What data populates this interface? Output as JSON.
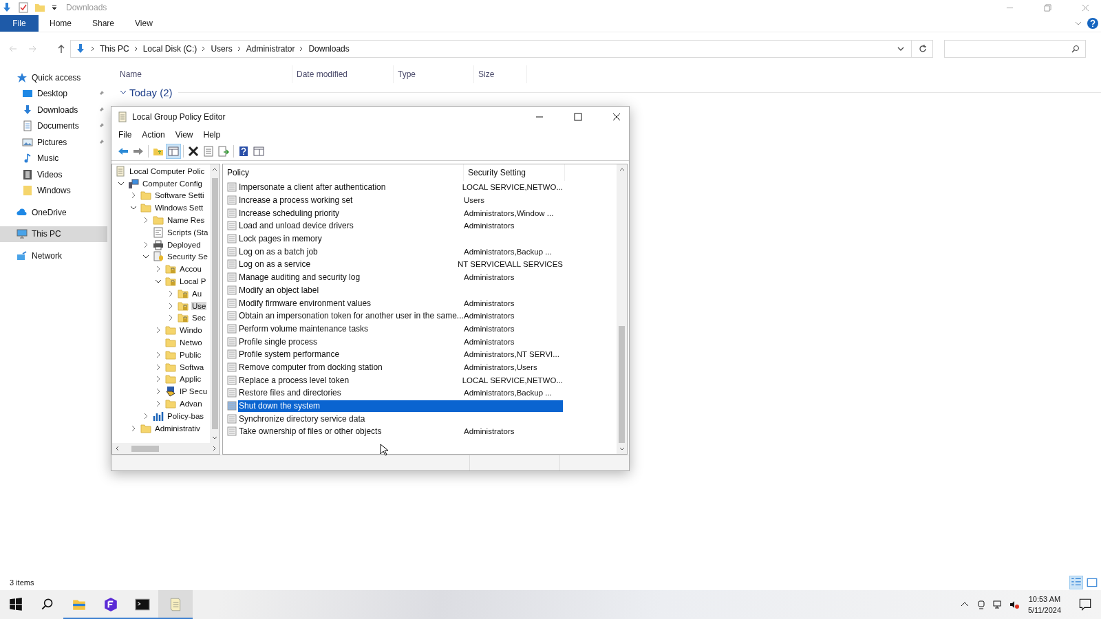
{
  "explorer": {
    "title": "Downloads",
    "ribbon_tabs": [
      {
        "label": "File",
        "selected": true
      },
      {
        "label": "Home",
        "selected": false
      },
      {
        "label": "Share",
        "selected": false
      },
      {
        "label": "View",
        "selected": false
      }
    ],
    "breadcrumbs": [
      "This PC",
      "Local Disk (C:)",
      "Users",
      "Administrator",
      "Downloads"
    ],
    "nav": [
      {
        "label": "Quick access",
        "kind": "star",
        "pinned": false,
        "selected": false,
        "indent": false
      },
      {
        "label": "Desktop",
        "kind": "desktop",
        "pinned": true,
        "selected": false,
        "indent": true
      },
      {
        "label": "Downloads",
        "kind": "download",
        "pinned": true,
        "selected": false,
        "indent": true
      },
      {
        "label": "Documents",
        "kind": "document",
        "pinned": true,
        "selected": false,
        "indent": true
      },
      {
        "label": "Pictures",
        "kind": "picture",
        "pinned": true,
        "selected": false,
        "indent": true
      },
      {
        "label": "Music",
        "kind": "music",
        "pinned": false,
        "selected": false,
        "indent": true
      },
      {
        "label": "Videos",
        "kind": "video",
        "pinned": false,
        "selected": false,
        "indent": true
      },
      {
        "label": "Windows",
        "kind": "folder",
        "pinned": false,
        "selected": false,
        "indent": true
      },
      {
        "label": "OneDrive",
        "kind": "cloud",
        "pinned": false,
        "selected": false,
        "indent": false
      },
      {
        "label": "This PC",
        "kind": "pc",
        "pinned": false,
        "selected": true,
        "indent": false
      },
      {
        "label": "Network",
        "kind": "network",
        "pinned": false,
        "selected": false,
        "indent": false
      }
    ],
    "columns": [
      "Name",
      "Date modified",
      "Type",
      "Size"
    ],
    "group": "Today (2)",
    "status": "3 items"
  },
  "gpe": {
    "title": "Local Group Policy Editor",
    "menu": [
      "File",
      "Action",
      "View",
      "Help"
    ],
    "tree": [
      {
        "label": "Local Computer Polic",
        "kind": "document",
        "selected": false,
        "children": [
          {
            "label": "Computer Config",
            "kind": "computer",
            "expanded": true,
            "selected": false,
            "children": [
              {
                "label": "Software Setti",
                "kind": "folder",
                "expanded": false,
                "selected": false
              },
              {
                "label": "Windows Sett",
                "kind": "folder",
                "expanded": true,
                "selected": false,
                "children": [
                  {
                    "label": "Name Res",
                    "kind": "folder",
                    "expanded": false,
                    "selected": false
                  },
                  {
                    "label": "Scripts (Sta",
                    "kind": "script",
                    "selected": false
                  },
                  {
                    "label": "Deployed",
                    "kind": "printer",
                    "expanded": false,
                    "selected": false
                  },
                  {
                    "label": "Security Se",
                    "kind": "shield",
                    "expanded": true,
                    "selected": false,
                    "children": [
                      {
                        "label": "Accou",
                        "kind": "secure-folder",
                        "expanded": false,
                        "selected": false
                      },
                      {
                        "label": "Local P",
                        "kind": "secure-folder",
                        "expanded": true,
                        "selected": false,
                        "children": [
                          {
                            "label": "Au",
                            "kind": "secure-folder",
                            "expanded": false,
                            "selected": false
                          },
                          {
                            "label": "Use",
                            "kind": "secure-folder",
                            "expanded": false,
                            "selected": true
                          },
                          {
                            "label": "Sec",
                            "kind": "secure-folder",
                            "expanded": false,
                            "selected": false
                          }
                        ]
                      },
                      {
                        "label": "Windo",
                        "kind": "folder",
                        "expanded": false,
                        "selected": false
                      },
                      {
                        "label": "Netwo",
                        "kind": "folder",
                        "selected": false
                      },
                      {
                        "label": "Public",
                        "kind": "folder",
                        "expanded": false,
                        "selected": false
                      },
                      {
                        "label": "Softwa",
                        "kind": "folder",
                        "expanded": false,
                        "selected": false
                      },
                      {
                        "label": "Applic",
                        "kind": "folder",
                        "expanded": false,
                        "selected": false
                      },
                      {
                        "label": "IP Secu",
                        "kind": "ipsec",
                        "expanded": false,
                        "selected": false
                      },
                      {
                        "label": "Advan",
                        "kind": "folder",
                        "expanded": false,
                        "selected": false
                      }
                    ]
                  },
                  {
                    "label": "Policy-bas",
                    "kind": "chart",
                    "expanded": false,
                    "selected": false
                  }
                ]
              },
              {
                "label": "Administrativ",
                "kind": "folder",
                "expanded": false,
                "selected": false
              }
            ]
          }
        ]
      }
    ],
    "columns": [
      "Policy",
      "Security Setting"
    ],
    "rows": [
      {
        "policy": "Impersonate a client after authentication",
        "setting": "LOCAL SERVICE,NETWO...",
        "selected": false
      },
      {
        "policy": "Increase a process working set",
        "setting": "Users",
        "selected": false
      },
      {
        "policy": "Increase scheduling priority",
        "setting": "Administrators,Window ...",
        "selected": false
      },
      {
        "policy": "Load and unload device drivers",
        "setting": "Administrators",
        "selected": false
      },
      {
        "policy": "Lock pages in memory",
        "setting": "",
        "selected": false
      },
      {
        "policy": "Log on as a batch job",
        "setting": "Administrators,Backup ...",
        "selected": false
      },
      {
        "policy": "Log on as a service",
        "setting": "NT SERVICE\\ALL SERVICES",
        "selected": false
      },
      {
        "policy": "Manage auditing and security log",
        "setting": "Administrators",
        "selected": false
      },
      {
        "policy": "Modify an object label",
        "setting": "",
        "selected": false
      },
      {
        "policy": "Modify firmware environment values",
        "setting": "Administrators",
        "selected": false
      },
      {
        "policy": "Obtain an impersonation token for another user in the same...",
        "setting": "Administrators",
        "selected": false
      },
      {
        "policy": "Perform volume maintenance tasks",
        "setting": "Administrators",
        "selected": false
      },
      {
        "policy": "Profile single process",
        "setting": "Administrators",
        "selected": false
      },
      {
        "policy": "Profile system performance",
        "setting": "Administrators,NT SERVI...",
        "selected": false
      },
      {
        "policy": "Remove computer from docking station",
        "setting": "Administrators,Users",
        "selected": false
      },
      {
        "policy": "Replace a process level token",
        "setting": "LOCAL SERVICE,NETWO...",
        "selected": false
      },
      {
        "policy": "Restore files and directories",
        "setting": "Administrators,Backup ...",
        "selected": false
      },
      {
        "policy": "Shut down the system",
        "setting": "",
        "selected": true
      },
      {
        "policy": "Synchronize directory service data",
        "setting": "",
        "selected": false
      },
      {
        "policy": "Take ownership of files or other objects",
        "setting": "Administrators",
        "selected": false
      }
    ]
  },
  "taskbar": {
    "time": "10:53 AM",
    "date": "5/11/2024"
  }
}
